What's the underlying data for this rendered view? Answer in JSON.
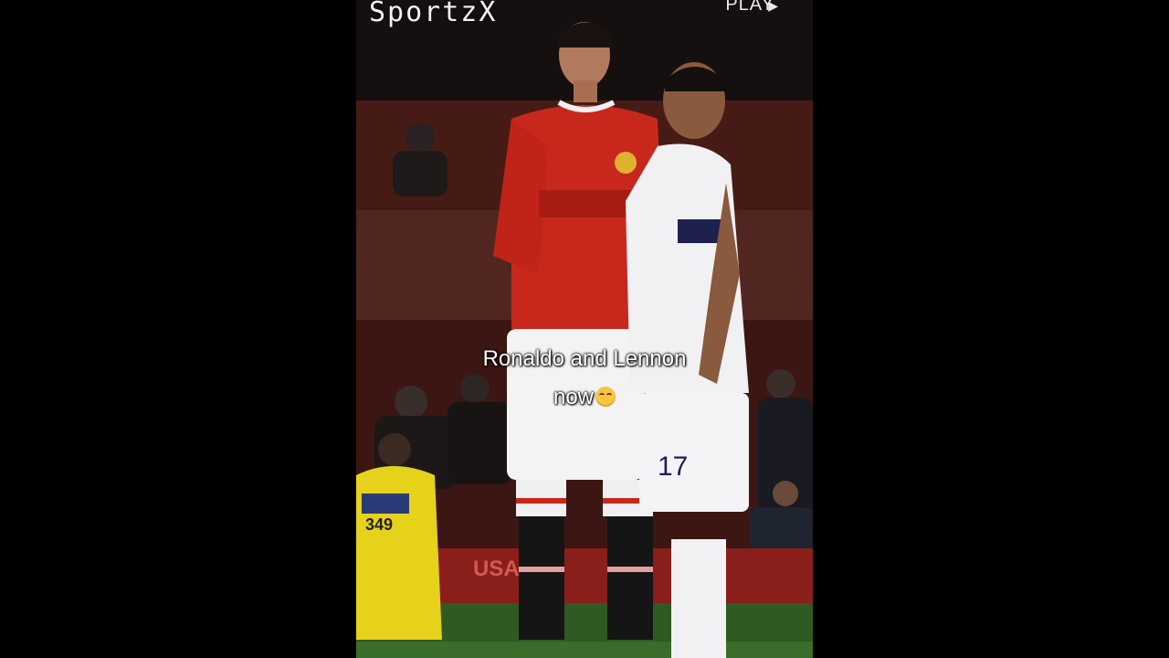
{
  "watermark": "SportzX",
  "player_controls": {
    "play_label": "PLAY",
    "play_icon": "play-triangle-icon"
  },
  "caption": {
    "line1": "Ronaldo and Lennon",
    "line2": "now",
    "emoji": "pleading-face-emoji"
  },
  "scene_text": {
    "player_number": "17",
    "steward_vest_number": "349",
    "board_text": "USA"
  },
  "colors": {
    "background": "#000000",
    "red_kit": "#c8281c",
    "white_kit": "#f1f1f3",
    "steward_vest": "#e6d21a"
  }
}
